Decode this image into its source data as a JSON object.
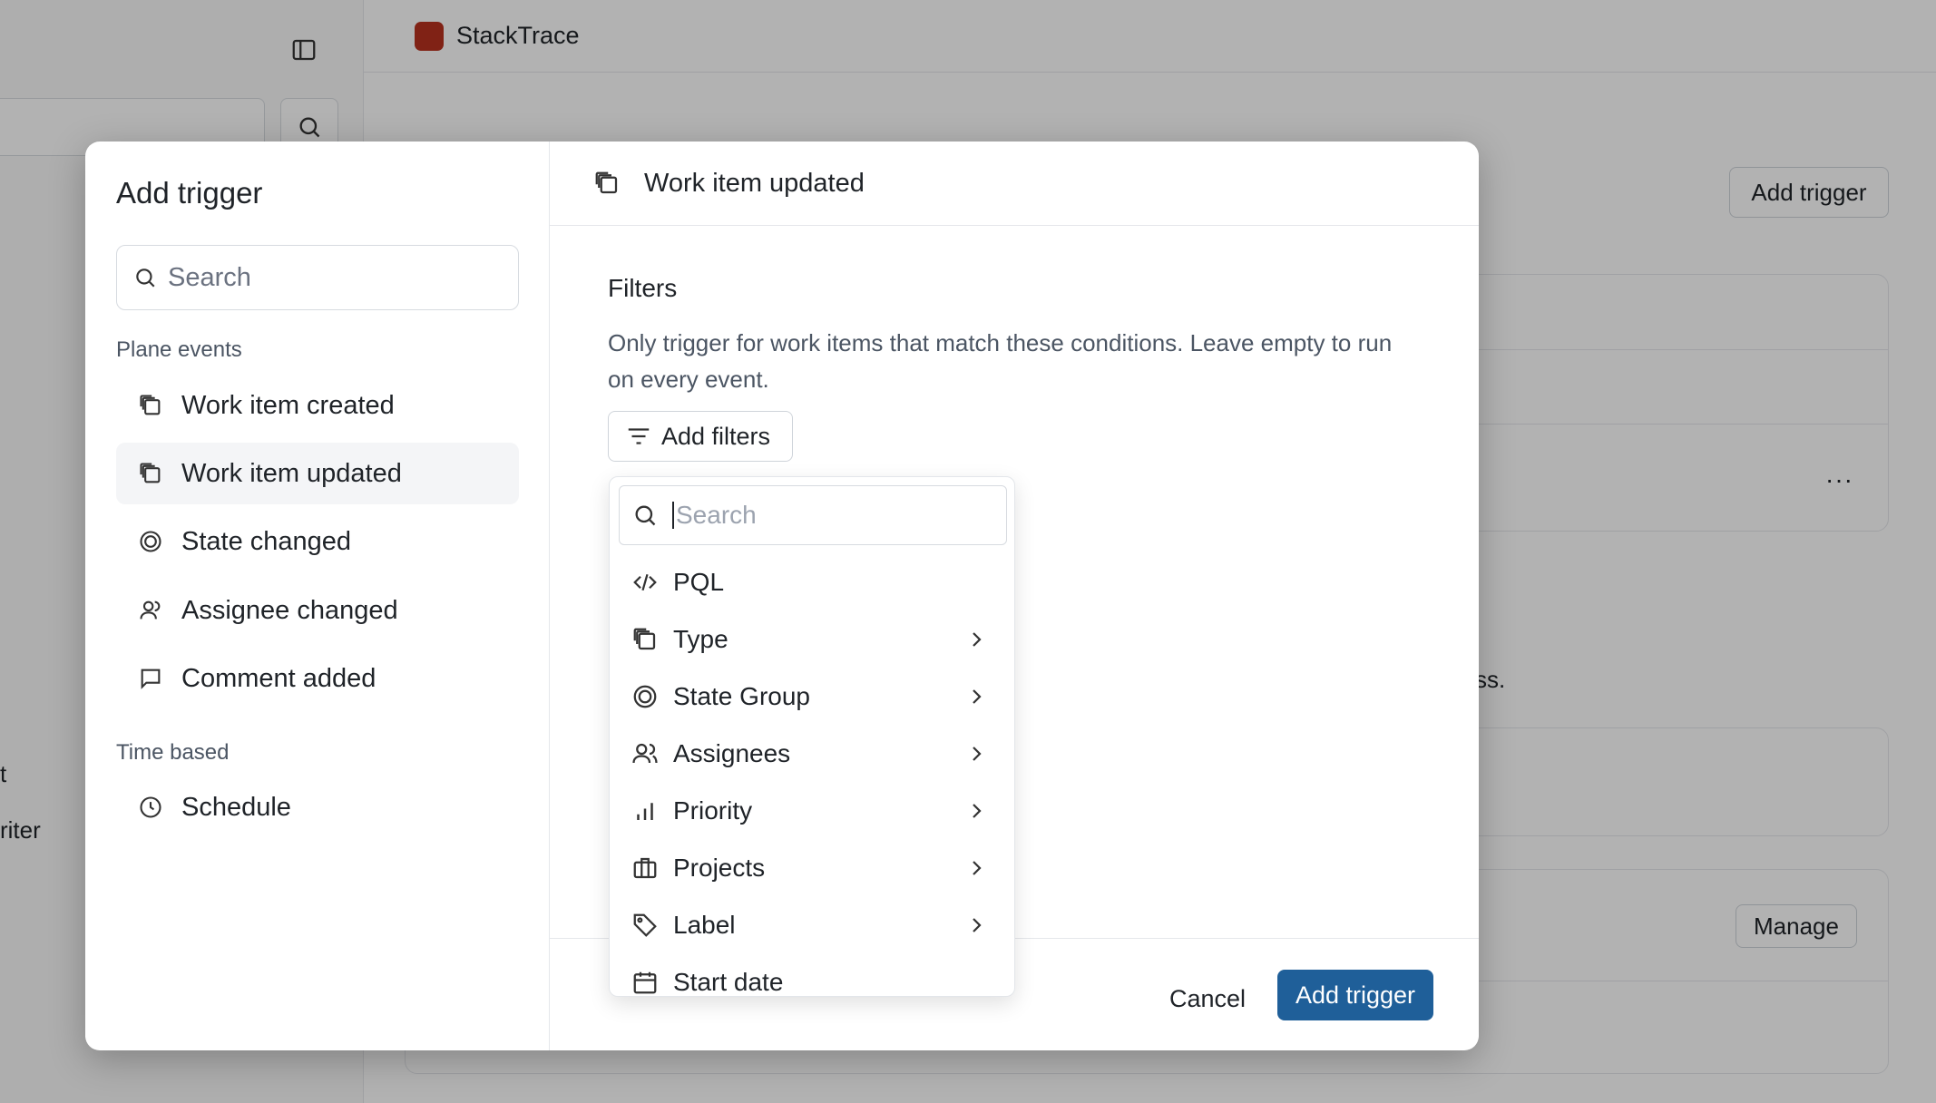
{
  "app": {
    "brand": "StackTrace"
  },
  "background": {
    "add_trigger_label": "Add trigger",
    "manage_label": "Manage",
    "partial_text_1": "ss.",
    "partial_text_2": "t",
    "partial_text_3": "riter"
  },
  "modal": {
    "title": "Add trigger",
    "search_placeholder": "Search",
    "groups": [
      {
        "label": "Plane events",
        "items": [
          {
            "label": "Work item created",
            "icon": "work-item-icon"
          },
          {
            "label": "Work item updated",
            "icon": "work-item-icon",
            "selected": true
          },
          {
            "label": "State changed",
            "icon": "state-icon"
          },
          {
            "label": "Assignee changed",
            "icon": "user-icon"
          },
          {
            "label": "Comment added",
            "icon": "comment-icon"
          }
        ]
      },
      {
        "label": "Time based",
        "items": [
          {
            "label": "Schedule",
            "icon": "clock-icon"
          }
        ]
      }
    ],
    "detail": {
      "title": "Work item updated",
      "filters_title": "Filters",
      "filters_description": "Only trigger for work items that match these conditions. Leave empty to run on every event.",
      "add_filters_label": "Add filters"
    },
    "footer": {
      "cancel_label": "Cancel",
      "submit_label": "Add trigger"
    }
  },
  "filter_dropdown": {
    "search_placeholder": "Search",
    "items": [
      {
        "label": "PQL",
        "icon": "code-icon",
        "submenu": false
      },
      {
        "label": "Type",
        "icon": "work-item-icon",
        "submenu": true
      },
      {
        "label": "State Group",
        "icon": "state-icon",
        "submenu": true
      },
      {
        "label": "Assignees",
        "icon": "users-icon",
        "submenu": true
      },
      {
        "label": "Priority",
        "icon": "priority-icon",
        "submenu": true
      },
      {
        "label": "Projects",
        "icon": "briefcase-icon",
        "submenu": true
      },
      {
        "label": "Label",
        "icon": "tag-icon",
        "submenu": true
      },
      {
        "label": "Start date",
        "icon": "calendar-icon",
        "submenu": false
      }
    ]
  },
  "colors": {
    "primary": "#1f5f99",
    "brand": "#b8321f"
  }
}
